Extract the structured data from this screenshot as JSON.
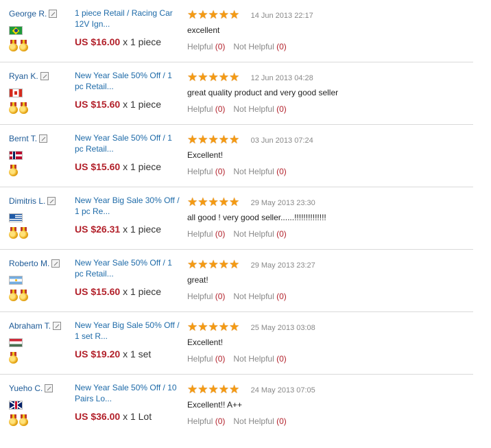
{
  "reviews": [
    {
      "buyer": "George R.",
      "flag": "flag-brazil",
      "medals": 2,
      "edited": false,
      "product": "1 piece Retail / Racing Car 12V Ign...",
      "price": "US $16.00",
      "quantity": "x 1 piece",
      "rating": 5,
      "date": "14 Jun 2013 22:17",
      "comment": "excellent",
      "helpful_label": "Helpful",
      "helpful_count": "(0)",
      "not_helpful_label": "Not Helpful",
      "not_helpful_count": "(0)"
    },
    {
      "buyer": "Ryan K.",
      "flag": "flag-canada",
      "medals": 2,
      "edited": false,
      "product": "New Year Sale 50% Off / 1 pc Retail...",
      "price": "US $15.60",
      "quantity": "x 1 piece",
      "rating": 5,
      "date": "12 Jun 2013 04:28",
      "comment": "great quality product and very good seller",
      "helpful_label": "Helpful",
      "helpful_count": "(0)",
      "not_helpful_label": "Not Helpful",
      "not_helpful_count": "(0)"
    },
    {
      "buyer": "Bernt T.",
      "flag": "flag-norway",
      "medals": 1,
      "edited": false,
      "product": "New Year Sale 50% Off / 1 pc Retail...",
      "price": "US $15.60",
      "quantity": "x 1 piece",
      "rating": 5,
      "date": "03 Jun 2013 07:24",
      "comment": "Excellent!",
      "helpful_label": "Helpful",
      "helpful_count": "(0)",
      "not_helpful_label": "Not Helpful",
      "not_helpful_count": "(0)"
    },
    {
      "buyer": "Dimitris L.",
      "flag": "flag-greece",
      "medals": 2,
      "edited": false,
      "product": "New Year Big Sale 30% Off / 1 pc Re...",
      "price": "US $26.31",
      "quantity": "x 1 piece",
      "rating": 5,
      "date": "29 May 2013 23:30",
      "comment": "all good ! very good seller......!!!!!!!!!!!!!!",
      "helpful_label": "Helpful",
      "helpful_count": "(0)",
      "not_helpful_label": "Not Helpful",
      "not_helpful_count": "(0)"
    },
    {
      "buyer": "Roberto M.",
      "flag": "flag-argentina",
      "medals": 2,
      "edited": true,
      "product": "New Year Sale 50% Off / 1 pc Retail...",
      "price": "US $15.60",
      "quantity": "x 1 piece",
      "rating": 5,
      "date": "29 May 2013 23:27",
      "comment": "great!",
      "helpful_label": "Helpful",
      "helpful_count": "(0)",
      "not_helpful_label": "Not Helpful",
      "not_helpful_count": "(0)"
    },
    {
      "buyer": "Abraham T.",
      "flag": "flag-hungary",
      "medals": 1,
      "edited": false,
      "product": "New Year Big Sale 50% Off / 1 set R...",
      "price": "US $19.20",
      "quantity": "x 1 set",
      "rating": 5,
      "date": "25 May 2013 03:08",
      "comment": "Excellent!",
      "helpful_label": "Helpful",
      "helpful_count": "(0)",
      "not_helpful_label": "Not Helpful",
      "not_helpful_count": "(0)"
    },
    {
      "buyer": "Yueho C.",
      "flag": "flag-uk",
      "medals": 2,
      "edited": true,
      "product": "New Year Sale 50% Off / 10 Pairs Lo...",
      "price": "US $36.00",
      "quantity": "x 1 Lot",
      "rating": 5,
      "date": "24 May 2013 07:05",
      "comment": "Excellent!! A++",
      "helpful_label": "Helpful",
      "helpful_count": "(0)",
      "not_helpful_label": "Not Helpful",
      "not_helpful_count": "(0)"
    }
  ],
  "colors": {
    "link": "#1d6aa8",
    "price": "#b2202a",
    "star": "#f49a13",
    "divider": "#d9d9d9"
  },
  "icons": {
    "star": "star-icon",
    "medal": "medal-icon",
    "edit": "edit-icon"
  }
}
